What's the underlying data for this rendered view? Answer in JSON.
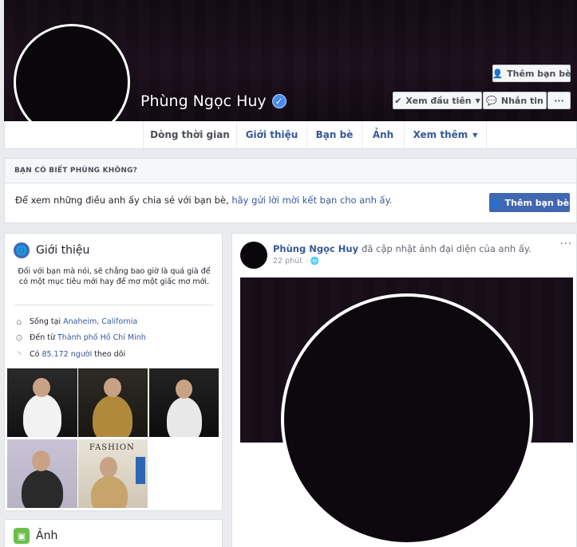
{
  "profile": {
    "name": "Phùng Ngọc Huy",
    "verified_icon": "verified-check-icon"
  },
  "cover_buttons": {
    "add_friend": "Thêm bạn bè",
    "see_first": "Xem đầu tiên",
    "message": "Nhắn tin",
    "more": "···"
  },
  "tabs": [
    {
      "label": "Dòng thời gian"
    },
    {
      "label": "Giới thiệu"
    },
    {
      "label": "Bạn bè"
    },
    {
      "label": "Ảnh"
    },
    {
      "label": "Xem thêm"
    }
  ],
  "know_box": {
    "heading": "BẠN CÓ BIẾT PHÙNG KHÔNG?",
    "text": "Để xem những điều anh ấy chia sẻ với bạn bè, ",
    "link": "hãy gửi lời mời kết bạn cho anh ấy.",
    "button": "Thêm bạn bè"
  },
  "intro": {
    "title": "Giới thiệu",
    "bio": "Đối với bạn mà nói, sẽ chẳng bao giờ là quá già để có một mục tiêu mới hay để mơ một giấc mơ mới.",
    "lives_prefix": "Sống tại",
    "lives_link": "Anaheim, California",
    "from_prefix": "Đến từ",
    "from_link": "Thành phố Hồ Chí Minh",
    "followers_prefix": "Có",
    "followers_link": "85.172 người",
    "followers_suffix": "theo dõi",
    "magazine_text": "FASHION"
  },
  "photos": {
    "title": "Ảnh"
  },
  "post": {
    "author": "Phùng Ngọc Huy",
    "action": "đã cập nhật ảnh đại diện của anh ấy.",
    "time": "22 phút",
    "more": "···"
  },
  "colors": {
    "brand": "#4267b2",
    "link": "#365899",
    "background": "#e9ebee"
  }
}
